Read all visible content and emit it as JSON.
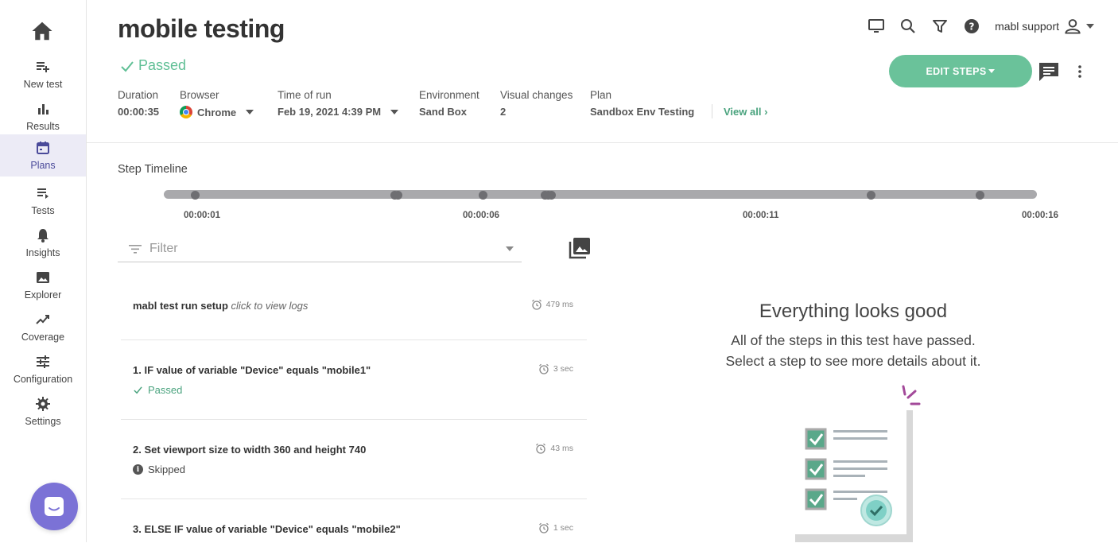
{
  "sidebar": {
    "home_icon": "home-icon",
    "items": [
      {
        "label": "New test",
        "icon": "new-test-icon",
        "active": false
      },
      {
        "label": "Results",
        "icon": "bar-chart-icon",
        "active": false
      },
      {
        "label": "Plans",
        "icon": "calendar-icon",
        "active": true
      },
      {
        "label": "Tests",
        "icon": "list-icon",
        "active": false
      },
      {
        "label": "Insights",
        "icon": "bell-icon",
        "active": false
      },
      {
        "label": "Explorer",
        "icon": "image-icon",
        "active": false
      },
      {
        "label": "Coverage",
        "icon": "trend-icon",
        "active": false
      },
      {
        "label": "Configuration",
        "icon": "sliders-icon",
        "active": false
      },
      {
        "label": "Settings",
        "icon": "gear-icon",
        "active": false
      }
    ]
  },
  "header": {
    "title": "mobile testing",
    "status": "Passed",
    "meta": {
      "duration_label": "Duration",
      "duration_value": "00:00:35",
      "browser_label": "Browser",
      "browser_value": "Chrome",
      "time_label": "Time of run",
      "time_value": "Feb 19, 2021 4:39 PM",
      "env_label": "Environment",
      "env_value": "Sand Box",
      "visual_label": "Visual changes",
      "visual_value": "2",
      "plan_label": "Plan",
      "plan_value": "Sandbox Env Testing"
    },
    "view_all": "View all",
    "user": "mabl support",
    "edit_steps": "EDIT STEPS"
  },
  "timeline": {
    "title": "Step Timeline",
    "labels": [
      "00:00:01",
      "00:00:06",
      "00:00:11",
      "00:00:16"
    ]
  },
  "filter": {
    "placeholder": "Filter"
  },
  "steps": [
    {
      "name": "mabl test run setup",
      "hint": "click to view logs",
      "time": "479 ms",
      "status": ""
    },
    {
      "name": "1. IF value of variable \"Device\" equals \"mobile1\"",
      "hint": "",
      "time": "3 sec",
      "status": "Passed"
    },
    {
      "name": "2. Set viewport size to width 360 and height 740",
      "hint": "",
      "time": "43 ms",
      "status": "Skipped"
    },
    {
      "name": "3. ELSE IF value of variable \"Device\" equals \"mobile2\"",
      "hint": "",
      "time": "1 sec",
      "status": ""
    }
  ],
  "panel": {
    "title": "Everything looks good",
    "line1": "All of the steps in this test have passed.",
    "line2": "Select a step to see more details about it."
  },
  "colors": {
    "accent_green": "#6ac29a",
    "nav_active_bg": "#ecebf6",
    "chat_purple": "#7b72d6"
  }
}
